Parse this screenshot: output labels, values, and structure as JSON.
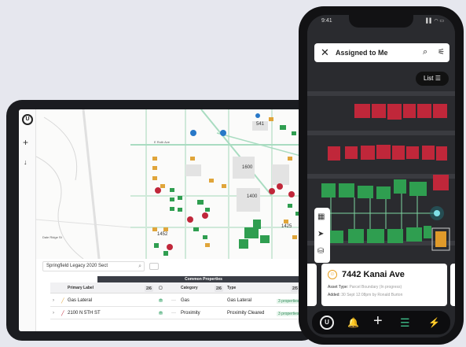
{
  "tablet": {
    "logo": "U",
    "zoom_in": "+",
    "menu_arrow": "↓",
    "map_labels": {
      "streets": [
        "E Roth Ave",
        "Dale Ridge St"
      ],
      "blocks": [
        "541",
        "1600",
        "1400",
        "1452",
        "1425"
      ]
    },
    "search_value": "Springfield Legacy 2020 Sect",
    "table": {
      "group_header": "Common Properties",
      "columns": [
        "Primary Label",
        "Category",
        "Type"
      ],
      "count_a": "2/6",
      "count_b": "2/5",
      "rows": [
        {
          "label": "Gas Lateral",
          "category": "Gas",
          "type": "Gas Lateral",
          "props": "3 properties"
        },
        {
          "label": "2100 N 5TH ST",
          "category": "Proximity",
          "type": "Proximity Cleared",
          "props": "3 properties"
        }
      ]
    }
  },
  "phone": {
    "status_time": "9:41",
    "status_icons": "▌▌ ◠ ▭",
    "search_title": "Assigned to Me",
    "list_button": "List",
    "card": {
      "icon": "☺",
      "title": "7442 Kanai Ave",
      "line1_key": "Asset Type:",
      "line1_val": "Parcel Boundary (In progress)",
      "line2_key": "Added:",
      "line2_val": "30 Sept 12:08pm by Ronald Burton"
    },
    "nav": {
      "logo": "U",
      "bell": "🔔",
      "add": "+",
      "tasks": "☰",
      "bolt": "⚡"
    }
  },
  "colors": {
    "accent_green": "#2f9e50",
    "asset_red": "#c0273a",
    "asset_green": "#2f9e50",
    "asset_orange": "#e09a2a"
  }
}
